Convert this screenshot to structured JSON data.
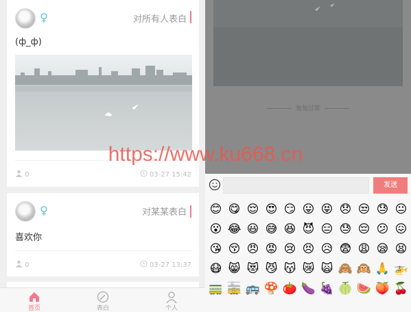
{
  "feed": [
    {
      "gender_icon": "female-symbol-icon",
      "gender_symbol": "♀",
      "target": "对所有人表白",
      "content": "(ф_ф)",
      "likes": "0",
      "time": "03-27 15:42"
    },
    {
      "gender_icon": "female-symbol-icon",
      "gender_symbol": "♀",
      "target": "对某某表白",
      "content": "喜欢你",
      "likes": "0",
      "time": "03-27 13:37"
    }
  ],
  "tabs": [
    {
      "label": "首页",
      "icon": "home-icon",
      "active": true
    },
    {
      "label": "表白",
      "icon": "compass-icon",
      "active": false
    },
    {
      "label": "个人",
      "icon": "person-icon",
      "active": false
    }
  ],
  "detail": {
    "footer": "匆匆过客"
  },
  "comment": {
    "emoji_icon": "smiley-icon",
    "input_value": "",
    "send_label": "发送"
  },
  "emojis": [
    "😊",
    "😋",
    "😌",
    "😍",
    "😏",
    "😛",
    "😝",
    "😞",
    "😒",
    "😓",
    "😐",
    "😮",
    "😂",
    "😃",
    "😅",
    "😆",
    "😈",
    "😑",
    "😓",
    "😔",
    "😕",
    "😖",
    "😘",
    "😚",
    "😠",
    "😡",
    "😢",
    "😣",
    "😥",
    "😨",
    "😩",
    "😪",
    "😫",
    "😷",
    "😸",
    "😻",
    "😼",
    "😽",
    "😿",
    "🙀",
    "🙈",
    "🙉",
    "🙏",
    "🚁",
    "🚃",
    "🚋",
    "🚌",
    "🍄",
    "🍅",
    "🍆",
    "🍇",
    "🍈",
    "🍉",
    "🍑",
    "🍒"
  ],
  "watermark": "https://www.ku668.cn",
  "brand_colors": {
    "accent": "#f2798c",
    "female": "#5bc4e0",
    "send": "#f07d7d"
  }
}
